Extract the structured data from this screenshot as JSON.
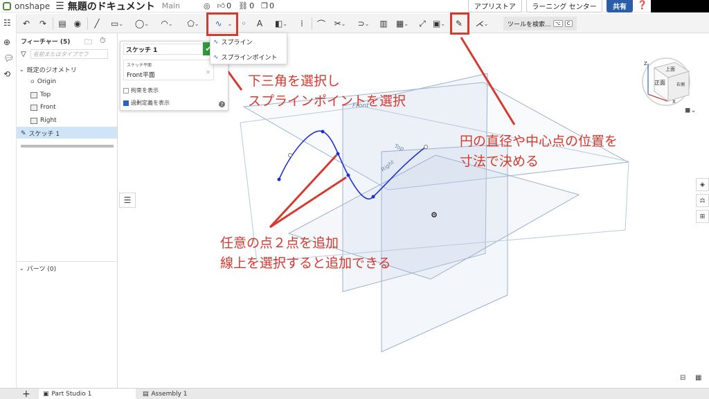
{
  "app": {
    "logo_text": "onshape",
    "doc_title": "無題のドキュメント",
    "branch": "Main",
    "likes": "0",
    "links": "0",
    "copies": "0",
    "appstore_label": "アプリストア",
    "learning_label": "ラーニング センター",
    "share_label": "共有"
  },
  "toolbar": {
    "search_label": "ツールを検索...",
    "search_shortcut_1": "⌥",
    "search_shortcut_2": "C"
  },
  "feature_panel": {
    "header": "フィーチャー (5)",
    "filter_placeholder": "名前またはタイプでフ",
    "default_geometry": "既定のジオメトリ",
    "items": [
      "Origin",
      "Top",
      "Front",
      "Right"
    ],
    "sketch": "スケッチ 1",
    "parts_header": "パーツ (0)"
  },
  "sketch_dialog": {
    "name": "スケッチ 1",
    "plane_label": "スケッチ平面",
    "plane_value": "Front平面",
    "show_constraints": "拘束を表示",
    "show_overdefined": "過剰定義を表示"
  },
  "dropdown": {
    "items": [
      "スプライン",
      "スプラインポイント"
    ]
  },
  "viewport": {
    "plane_labels": [
      "Front",
      "Top",
      "Right"
    ],
    "view_cube": {
      "z": "Z",
      "x": "X",
      "top": "上面",
      "front": "正面",
      "right": "右側"
    }
  },
  "annotations": {
    "a1_line1": "下三角を選択し",
    "a1_line2": "スプラインポイントを選択",
    "a2_line1": "円の直径や中心点の位置を",
    "a2_line2": "寸法で決める",
    "a3_line1": "任意の点２点を追加",
    "a3_line2": "線上を選択すると追加できる"
  },
  "tabs": {
    "part_studio": "Part Studio 1",
    "assembly": "Assembly 1"
  },
  "colors": {
    "annotation_red": "#d63a2f",
    "spline_blue": "#1d2fd0",
    "share_blue": "#2a5ea8",
    "ok_green": "#2e9a3a"
  }
}
